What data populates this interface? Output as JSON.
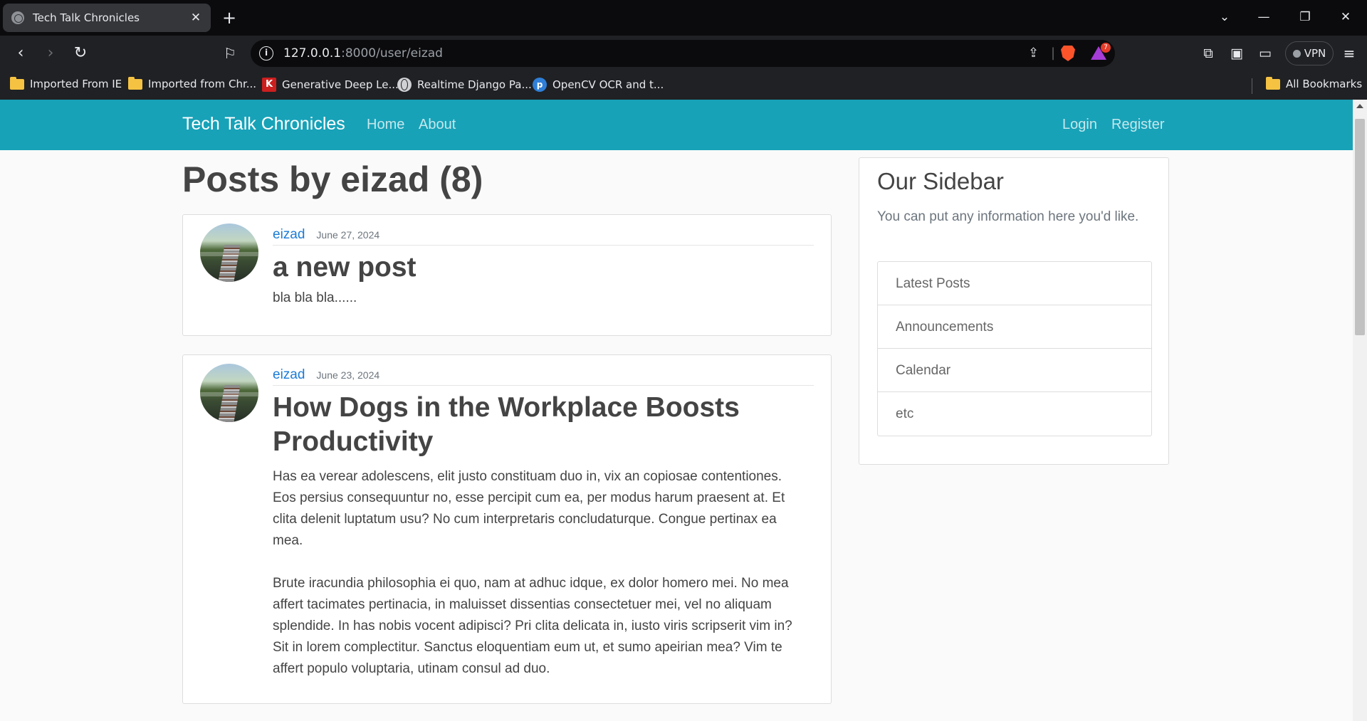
{
  "browser": {
    "tab_title": "Tech Talk Chronicles",
    "url_host": "127.0.0.1",
    "url_rest": ":8000/user/eizad",
    "vpn_label": "VPN",
    "rewards_count": "7",
    "bookmarks": [
      {
        "label": "Imported From IE",
        "icon": "folder-icon"
      },
      {
        "label": "Imported from Chr...",
        "icon": "folder-icon"
      },
      {
        "label": "Generative Deep Le...",
        "icon": "k-icon"
      },
      {
        "label": "Realtime Django Pa...",
        "icon": "globe-icon"
      },
      {
        "label": "OpenCV OCR and t...",
        "icon": "p-icon"
      }
    ],
    "all_bookmarks_label": "All Bookmarks"
  },
  "site": {
    "brand": "Tech Talk Chronicles",
    "nav_left": [
      "Home",
      "About"
    ],
    "nav_right": [
      "Login",
      "Register"
    ],
    "accent_color": "#17a2b8"
  },
  "page": {
    "title": "Posts by eizad (8)",
    "posts": [
      {
        "author": "eizad",
        "date": "June 27, 2024",
        "title": "a new post",
        "body": [
          "bla bla bla......"
        ]
      },
      {
        "author": "eizad",
        "date": "June 23, 2024",
        "title": "How Dogs in the Workplace Boosts Productivity",
        "body": [
          "Has ea verear adolescens, elit justo constituam duo in, vix an copiosae contentiones. Eos persius consequuntur no, esse percipit cum ea, per modus harum praesent at. Et clita delenit luptatum usu? No cum interpretaris concludaturque. Congue pertinax ea mea.",
          "Brute iracundia philosophia ei quo, nam at adhuc idque, ex dolor homero mei. No mea affert tacimates pertinacia, in maluisset dissentias consectetuer mei, vel no aliquam splendide. In has nobis vocent adipisci? Pri clita delicata in, iusto viris scripserit vim in? Sit in lorem complectitur. Sanctus eloquentiam eum ut, et sumo apeirian mea? Vim te affert populo voluptaria, utinam consul ad duo."
        ]
      }
    ]
  },
  "sidebar": {
    "title": "Our Sidebar",
    "text": "You can put any information here you'd like.",
    "items": [
      "Latest Posts",
      "Announcements",
      "Calendar",
      "etc"
    ]
  }
}
